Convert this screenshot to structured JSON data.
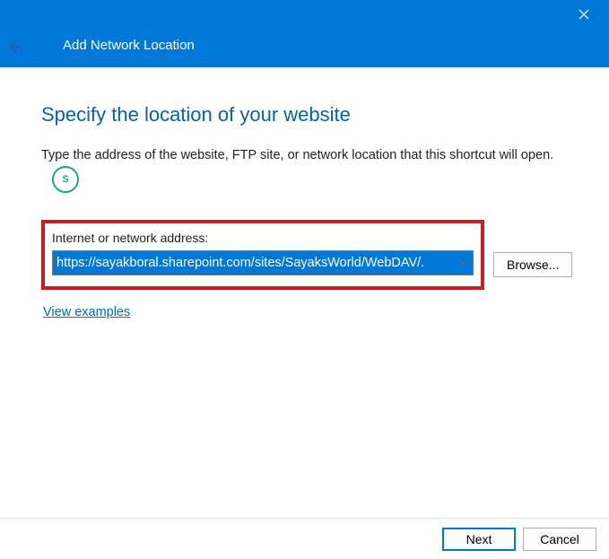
{
  "titlebar": {
    "title": "Add Network Location"
  },
  "content": {
    "heading": "Specify the location of your website",
    "instruction": "Type the address of the website, FTP site, or network location that this shortcut will open.",
    "field_label": "Internet or network address:",
    "address_value": "https://sayakboral.sharepoint.com/sites/SayaksWorld/WebDAV/.",
    "browse_label": "Browse...",
    "examples_link": "View examples"
  },
  "footer": {
    "next_label": "Next",
    "cancel_label": "Cancel"
  }
}
